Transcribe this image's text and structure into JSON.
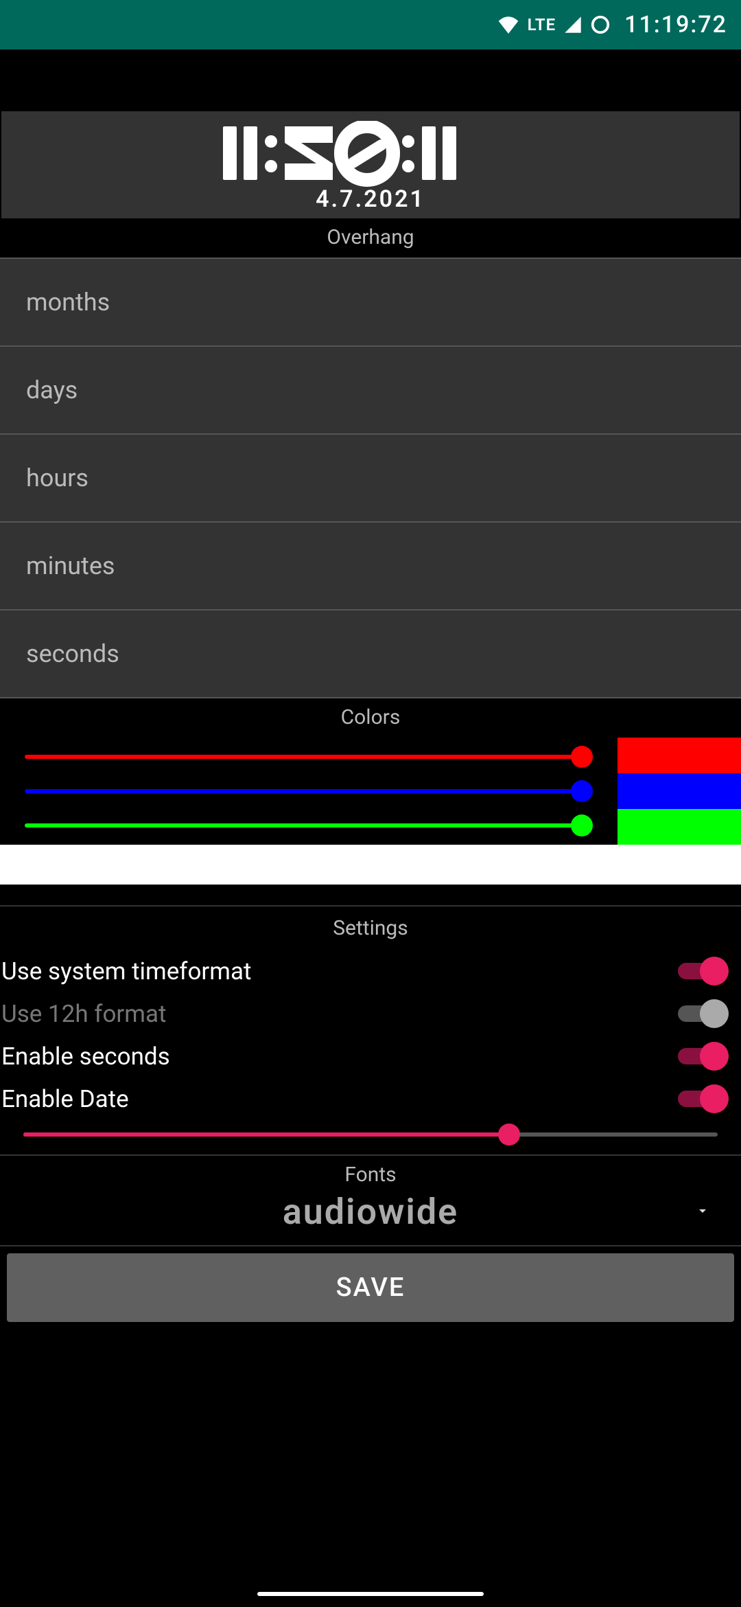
{
  "status": {
    "lte": "LTE",
    "time": "11:19:72"
  },
  "preview": {
    "time": "11:20:11",
    "date": "4.7.2021"
  },
  "overhang": {
    "label": "Overhang",
    "items": [
      "months",
      "days",
      "hours",
      "minutes",
      "seconds"
    ]
  },
  "colors": {
    "label": "Colors",
    "sliders": [
      {
        "color": "#ff0000",
        "value": 100
      },
      {
        "color": "#0000ff",
        "value": 100
      },
      {
        "color": "#00ff00",
        "value": 100
      }
    ],
    "swatches": [
      "#ff0000",
      "#0000ff",
      "#00ff00"
    ],
    "result": "#ffffff"
  },
  "settings": {
    "label": "Settings",
    "rows": [
      {
        "label": "Use system timeformat",
        "on": true,
        "disabled": false
      },
      {
        "label": "Use 12h format",
        "on": false,
        "disabled": true
      },
      {
        "label": "Enable seconds",
        "on": true,
        "disabled": false
      },
      {
        "label": "Enable Date",
        "on": true,
        "disabled": false
      }
    ],
    "slider_value": 70
  },
  "fonts": {
    "label": "Fonts",
    "selected": "audiowide"
  },
  "save_label": "SAVE"
}
